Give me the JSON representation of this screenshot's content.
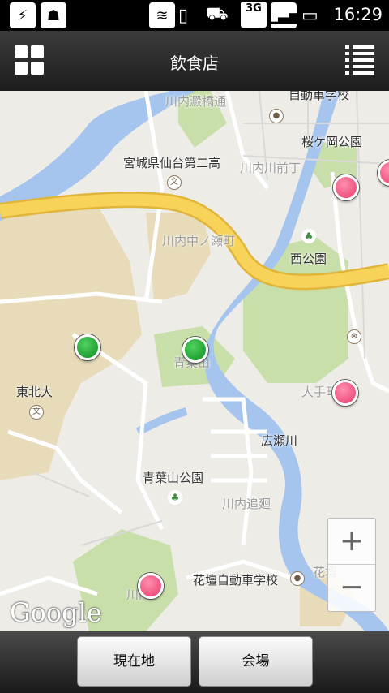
{
  "status_bar": {
    "time": "16:29",
    "network": "3G",
    "icons": [
      "usb-icon",
      "android-debug-icon",
      "wifi-icon",
      "vibrate-icon",
      "car-mode-icon",
      "network-3g-icon",
      "signal-icon",
      "battery-charging-icon"
    ]
  },
  "title_bar": {
    "title": "飲食店",
    "left_icon": "grid-menu-icon",
    "right_icon": "list-icon"
  },
  "map": {
    "labels": {
      "kawauchi_bridge": "川内澱橋通",
      "driving_school_top": "自動車学校",
      "sakuragaoka": "桜ケ岡公園",
      "miyagi_school": "宮城県仙台第二高",
      "kawauchi_mae": "川内川前丁",
      "kawauchi_naka": "川内中ノ瀬町",
      "nishi_park": "西公園",
      "aobayama": "青葉山",
      "tohoku_univ": "東北大",
      "otemachi": "大手町",
      "hirose_river": "広瀬川",
      "aobayama_park": "青葉山公園",
      "kawauchi_oimawari": "川内追廻",
      "kadan_school": "花壇自動車学校",
      "kadan": "花壇",
      "kawauchi_bottom": "川内"
    },
    "pins": [
      {
        "name": "green",
        "color": "green"
      },
      {
        "name": "green",
        "color": "green"
      },
      {
        "name": "pink",
        "color": "pink"
      },
      {
        "name": "pink",
        "color": "pink"
      },
      {
        "name": "pink",
        "color": "pink"
      },
      {
        "name": "pink",
        "color": "pink"
      }
    ],
    "zoom": {
      "in": "+",
      "out": "−"
    },
    "attribution": "Google"
  },
  "bottom_bar": {
    "current_location": "現在地",
    "venue": "会場"
  },
  "colors": {
    "water": "#a5c5ee",
    "park": "#c9dfaa",
    "campus": "#e7dbb9",
    "highway": "#f8d35a"
  }
}
